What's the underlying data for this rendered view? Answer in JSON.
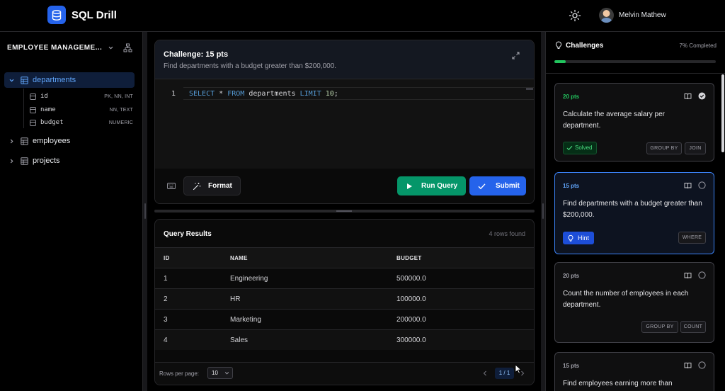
{
  "header": {
    "app_title": "SQL Drill",
    "user_name": "Melvin Mathew"
  },
  "sidebar": {
    "database_title": "EMPLOYEE MANAGEME...",
    "tables": [
      {
        "name": "departments",
        "expanded": true,
        "columns": [
          {
            "name": "id",
            "type": "PK, NN, INT"
          },
          {
            "name": "name",
            "type": "NN, TEXT"
          },
          {
            "name": "budget",
            "type": "NUMERIC"
          }
        ]
      },
      {
        "name": "employees",
        "expanded": false
      },
      {
        "name": "projects",
        "expanded": false
      }
    ]
  },
  "editor": {
    "challenge_title": "Challenge: 15 pts",
    "challenge_desc": "Find departments with a budget greater than $200,000.",
    "line_number": "1",
    "code_tokens": [
      "SELECT",
      "*",
      "FROM",
      "departments",
      "LIMIT",
      "10",
      ";"
    ],
    "format_label": "Format",
    "run_label": "Run Query",
    "submit_label": "Submit"
  },
  "results": {
    "title": "Query Results",
    "count": "4 rows found",
    "columns": [
      "ID",
      "NAME",
      "BUDGET"
    ],
    "rows": [
      [
        "1",
        "Engineering",
        "500000.0"
      ],
      [
        "2",
        "HR",
        "100000.0"
      ],
      [
        "3",
        "Marketing",
        "200000.0"
      ],
      [
        "4",
        "Sales",
        "300000.0"
      ]
    ],
    "rows_per_page_label": "Rows per page:",
    "rows_per_page_value": "10",
    "page_indicator": "1 / 1"
  },
  "challenges": {
    "title": "Challenges",
    "completed": "7% Completed",
    "progress_fraction": 0.07,
    "cards": [
      {
        "pts": "20 pts",
        "desc": "Calculate the average salary per department.",
        "status_label": "Solved",
        "tags": [
          "GROUP BY",
          "JOIN"
        ]
      },
      {
        "pts": "15 pts",
        "desc": "Find departments with a budget greater than $200,000.",
        "hint_label": "Hint",
        "tags": [
          "WHERE"
        ]
      },
      {
        "pts": "20 pts",
        "desc": "Count the number of employees in each department.",
        "tags": [
          "GROUP BY",
          "COUNT"
        ]
      },
      {
        "pts": "15 pts",
        "desc": "Find employees earning more than"
      }
    ]
  },
  "colors": {
    "accent_blue": "#2563eb",
    "run_green": "#059669",
    "progress_green": "#22c55e"
  }
}
